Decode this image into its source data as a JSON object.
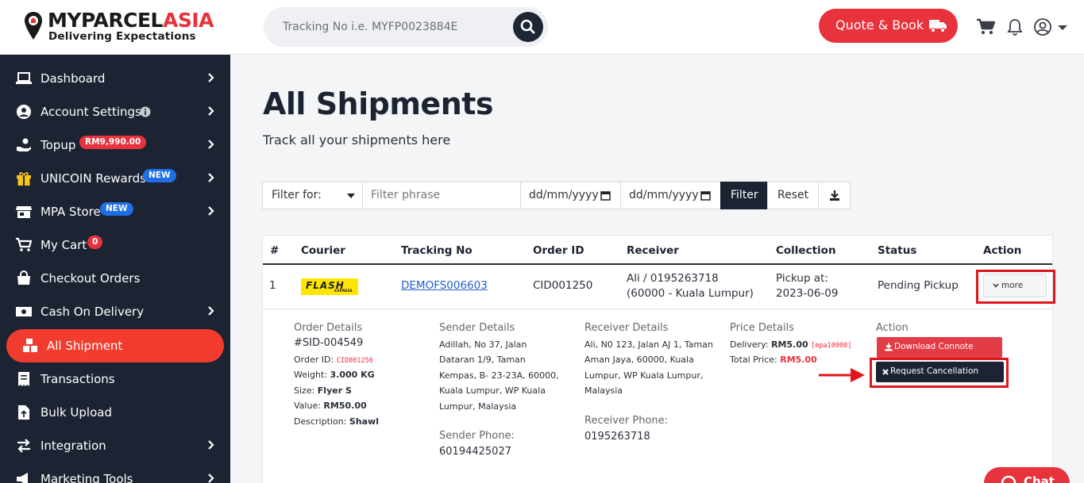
{
  "brand": {
    "name_main": "MYPARCEL",
    "name_accent": "ASIA",
    "tagline": "Delivering Expectations"
  },
  "header": {
    "search_placeholder": "Tracking No i.e. MYFP0023884E",
    "quote_label": "Quote & Book"
  },
  "sidebar": {
    "items": [
      {
        "label": "Dashboard"
      },
      {
        "label": "Account Settings"
      },
      {
        "label": "Topup",
        "badge": "RM9,990.00"
      },
      {
        "label": "UNICOIN Rewards",
        "badge": "NEW"
      },
      {
        "label": "MPA Store",
        "badge": "NEW"
      },
      {
        "label": "My Cart",
        "badge": "0"
      },
      {
        "label": "Checkout Orders"
      },
      {
        "label": "Cash On Delivery"
      },
      {
        "label": "All Shipment"
      },
      {
        "label": "Transactions"
      },
      {
        "label": "Bulk Upload"
      },
      {
        "label": "Integration"
      },
      {
        "label": "Marketing Tools"
      }
    ]
  },
  "main": {
    "title": "All Shipments",
    "subtitle": "Track all your shipments here",
    "filter": {
      "select_label": "Filter for:",
      "phrase_placeholder": "Filter phrase",
      "date_from": "dd/mm/yyyy",
      "date_to": "dd/mm/yyyy",
      "filter_label": "Filter",
      "reset_label": "Reset"
    },
    "table": {
      "columns": [
        "#",
        "Courier",
        "Tracking No",
        "Order ID",
        "Receiver",
        "Collection",
        "Status",
        "Action"
      ],
      "row": {
        "index": "1",
        "courier": "FLASH",
        "courier_sub": "EXPRESS",
        "tracking_no": "DEMOFS006603",
        "order_id": "CID001250",
        "receiver_line1": "Ali / 0195263718",
        "receiver_line2": "(60000 - Kuala Lumpur)",
        "collection_line1": "Pickup at:",
        "collection_line2": "2023-06-09",
        "status": "Pending Pickup",
        "action_label": "more"
      }
    },
    "details": {
      "order": {
        "heading": "Order Details",
        "sid": "#SID-004549",
        "order_id_label": "Order ID:",
        "order_id_value": "CID001250",
        "weight_label": "Weight:",
        "weight_value": "3.000 KG",
        "size_label": "Size:",
        "size_value": "Flyer S",
        "value_label": "Value:",
        "value_value": "RM50.00",
        "desc_label": "Description:",
        "desc_value": "Shawl"
      },
      "sender": {
        "heading": "Sender Details",
        "address": [
          "Adillah, No 37, Jalan",
          "Dataran 1/9, Taman",
          "Kempas, B- 23-23A, 60000,",
          "Kuala Lumpur, WP Kuala",
          "Lumpur, Malaysia"
        ],
        "phone_heading": "Sender Phone:",
        "phone": "60194425027"
      },
      "receiver": {
        "heading": "Receiver Details",
        "address": [
          "Ali, N0 123, Jalan AJ 1, Taman",
          "Aman Jaya, 60000, Kuala",
          "Lumpur, WP Kuala Lumpur,",
          "Malaysia"
        ],
        "phone_heading": "Receiver Phone:",
        "phone": "0195263718"
      },
      "price": {
        "heading": "Price Details",
        "delivery_label": "Delivery:",
        "delivery_value": "RM5.00",
        "promo": "[mpa10000]",
        "total_label": "Total Price:",
        "total_value": "RM5.00"
      },
      "action": {
        "heading": "Action",
        "download_label": "Download Connote",
        "cancel_label": "Request Cancellation"
      }
    }
  },
  "chat": {
    "label": "Chat"
  },
  "colors": {
    "brand_red": "#e8323c",
    "sidebar_bg": "#1c2433",
    "active_nav": "#f23c2f",
    "highlight": "#e0151d"
  }
}
